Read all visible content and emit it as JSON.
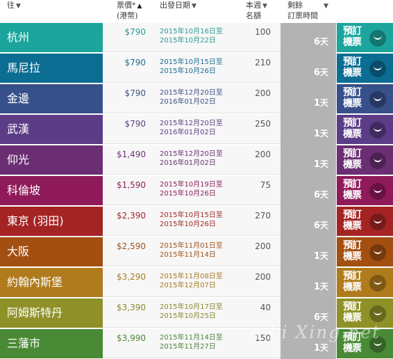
{
  "header": {
    "col_dest": "往",
    "col_price_line1": "票價*",
    "col_price_line2": "(港幣)",
    "col_date": "出發日期",
    "col_quota_line1": "本週",
    "col_quota_line2": "名額",
    "col_remain_line1": "剩餘",
    "col_remain_line2": "訂票時間",
    "sort_arrow": "▼",
    "sort_active_arrow": "▲"
  },
  "book_label": "預訂機票",
  "day_unit": "天",
  "rows": [
    {
      "dest": "杭州",
      "price": "$790",
      "date_from": "2015年10月16日至",
      "date_to": "2015年10月22日",
      "quota": "100",
      "days": "6",
      "color": "#1ba59c",
      "textcolor": "#2a9a94"
    },
    {
      "dest": "馬尼拉",
      "price": "$790",
      "date_from": "2015年10月15日至",
      "date_to": "2015年10月26日",
      "quota": "210",
      "days": "6",
      "color": "#0c6d93",
      "textcolor": "#1a6e90"
    },
    {
      "dest": "金邊",
      "price": "$790",
      "date_from": "2015年12月20日至",
      "date_to": "2016年01月02日",
      "quota": "200",
      "days": "1",
      "color": "#37508a",
      "textcolor": "#3d5186"
    },
    {
      "dest": "武漢",
      "price": "$790",
      "date_from": "2015年12月20日至",
      "date_to": "2016年01月02日",
      "quota": "250",
      "days": "1",
      "color": "#5b3c86",
      "textcolor": "#5a3f82"
    },
    {
      "dest": "仰光",
      "price": "$1,490",
      "date_from": "2015年12月20日至",
      "date_to": "2016年01月02日",
      "quota": "200",
      "days": "1",
      "color": "#6b2e72",
      "textcolor": "#6a3270"
    },
    {
      "dest": "科倫坡",
      "price": "$1,590",
      "date_from": "2015年10月19日至",
      "date_to": "2015年10月26日",
      "quota": "75",
      "days": "6",
      "color": "#8f1a5a",
      "textcolor": "#8c2058"
    },
    {
      "dest": "東京 (羽田)",
      "price": "$2,390",
      "date_from": "2015年10月15日至",
      "date_to": "2015年10月26日",
      "quota": "270",
      "days": "6",
      "color": "#a42424",
      "textcolor": "#a02828"
    },
    {
      "dest": "大阪",
      "price": "$2,590",
      "date_from": "2015年11月01日至",
      "date_to": "2015年11月14日",
      "quota": "200",
      "days": "1",
      "color": "#a44f12",
      "textcolor": "#a0521a"
    },
    {
      "dest": "約翰內斯堡",
      "price": "$3,290",
      "date_from": "2015年11月08日至",
      "date_to": "2015年12月07日",
      "quota": "200",
      "days": "1",
      "color": "#b07b1c",
      "textcolor": "#a87a22"
    },
    {
      "dest": "阿姆斯特丹",
      "price": "$3,390",
      "date_from": "2015年10月17日至",
      "date_to": "2015年10月25日",
      "quota": "40",
      "days": "6",
      "color": "#8f9128",
      "textcolor": "#878a2c"
    },
    {
      "dest": "三藩市",
      "price": "$3,990",
      "date_from": "2015年11月14日至",
      "date_to": "2015年11月27日",
      "quota": "150",
      "days": "1",
      "color": "#4a8a36",
      "textcolor": "#4c863a"
    }
  ],
  "watermark": "a Li Xing.net"
}
